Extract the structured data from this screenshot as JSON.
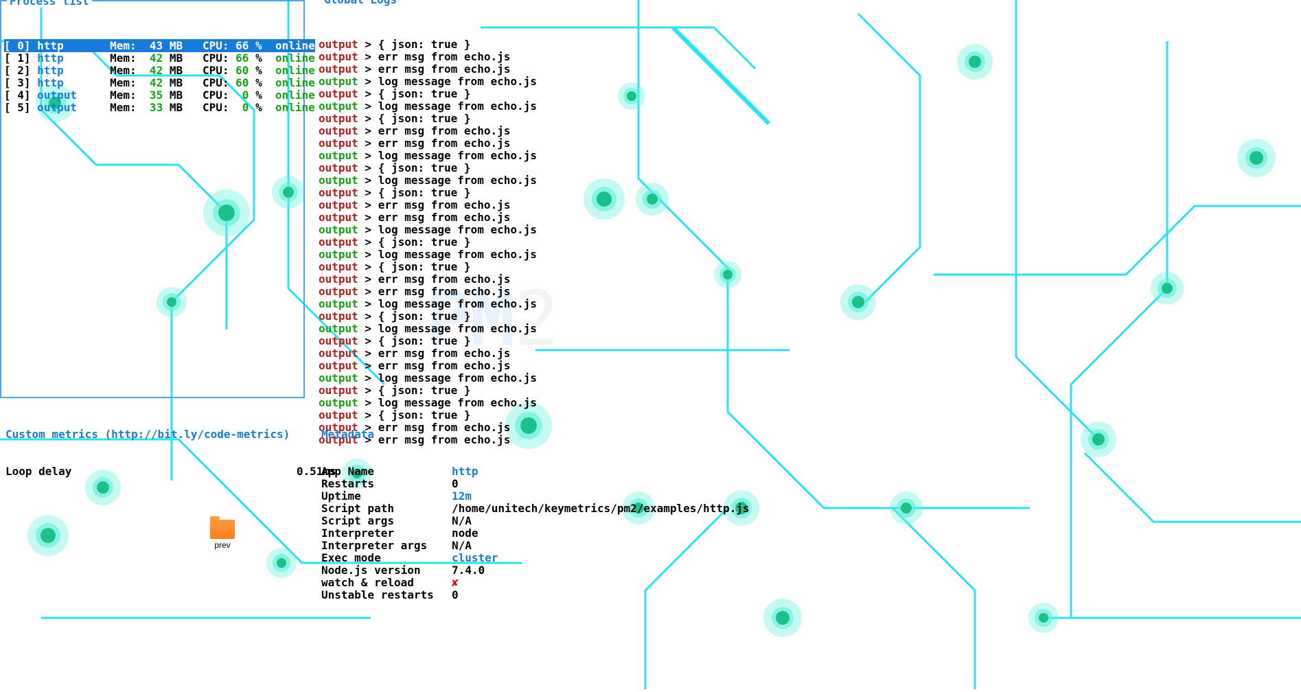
{
  "process_list": {
    "title": "Process list",
    "selected_row": {
      "id": "0",
      "name": "http",
      "mem": "43",
      "mem_unit": "MB",
      "cpu": "66",
      "status": "online"
    },
    "rows": [
      {
        "id": "1",
        "name": "http",
        "mem": "42",
        "mem_unit": "MB",
        "cpu": "66",
        "status": "online"
      },
      {
        "id": "2",
        "name": "http",
        "mem": "42",
        "mem_unit": "MB",
        "cpu": "60",
        "status": "online"
      },
      {
        "id": "3",
        "name": "http",
        "mem": "42",
        "mem_unit": "MB",
        "cpu": "60",
        "status": "online"
      },
      {
        "id": "4",
        "name": "output",
        "mem": "35",
        "mem_unit": "MB",
        "cpu": "0",
        "status": "online"
      },
      {
        "id": "5",
        "name": "output",
        "mem": "33",
        "mem_unit": "MB",
        "cpu": "0",
        "status": "online"
      }
    ]
  },
  "logs": {
    "title": "Global Logs",
    "lines": [
      {
        "label_color": "red",
        "msg": "{ json: true }"
      },
      {
        "label_color": "red",
        "msg": "err msg from echo.js"
      },
      {
        "label_color": "red",
        "msg": "err msg from echo.js"
      },
      {
        "label_color": "green",
        "msg": "log message from echo.js"
      },
      {
        "label_color": "red",
        "msg": "{ json: true }"
      },
      {
        "label_color": "green",
        "msg": "log message from echo.js"
      },
      {
        "label_color": "red",
        "msg": "{ json: true }"
      },
      {
        "label_color": "red",
        "msg": "err msg from echo.js"
      },
      {
        "label_color": "red",
        "msg": "err msg from echo.js"
      },
      {
        "label_color": "green",
        "msg": "log message from echo.js"
      },
      {
        "label_color": "red",
        "msg": "{ json: true }"
      },
      {
        "label_color": "green",
        "msg": "log message from echo.js"
      },
      {
        "label_color": "red",
        "msg": "{ json: true }"
      },
      {
        "label_color": "red",
        "msg": "err msg from echo.js"
      },
      {
        "label_color": "red",
        "msg": "err msg from echo.js"
      },
      {
        "label_color": "green",
        "msg": "log message from echo.js"
      },
      {
        "label_color": "red",
        "msg": "{ json: true }"
      },
      {
        "label_color": "green",
        "msg": "log message from echo.js"
      },
      {
        "label_color": "red",
        "msg": "{ json: true }"
      },
      {
        "label_color": "red",
        "msg": "err msg from echo.js"
      },
      {
        "label_color": "red",
        "msg": "err msg from echo.js"
      },
      {
        "label_color": "green",
        "msg": "log message from echo.js"
      },
      {
        "label_color": "red",
        "msg": "{ json: true }"
      },
      {
        "label_color": "green",
        "msg": "log message from echo.js"
      },
      {
        "label_color": "red",
        "msg": "{ json: true }"
      },
      {
        "label_color": "red",
        "msg": "err msg from echo.js"
      },
      {
        "label_color": "red",
        "msg": "err msg from echo.js"
      },
      {
        "label_color": "green",
        "msg": "log message from echo.js"
      },
      {
        "label_color": "red",
        "msg": "{ json: true }"
      },
      {
        "label_color": "green",
        "msg": "log message from echo.js"
      },
      {
        "label_color": "red",
        "msg": "{ json: true }"
      },
      {
        "label_color": "red",
        "msg": "err msg from echo.js"
      },
      {
        "label_color": "red",
        "msg": "err msg from echo.js"
      }
    ],
    "label": "output",
    "sep": ">"
  },
  "metrics": {
    "title": "Custom metrics (http://bit.ly/code-metrics)",
    "rows": [
      {
        "name": "Loop delay",
        "value": "0.51ms"
      }
    ]
  },
  "metadata": {
    "title": "Metadata",
    "rows": [
      {
        "k": "App Name",
        "v": "http",
        "color": "blue"
      },
      {
        "k": "Restarts",
        "v": "0",
        "color": ""
      },
      {
        "k": "Uptime",
        "v": "12m",
        "color": "blue"
      },
      {
        "k": "Script path",
        "v": "/home/unitech/keymetrics/pm2/examples/http.js",
        "color": ""
      },
      {
        "k": "Script args",
        "v": "N/A",
        "color": ""
      },
      {
        "k": "Interpreter",
        "v": "node",
        "color": ""
      },
      {
        "k": "Interpreter args",
        "v": "N/A",
        "color": ""
      },
      {
        "k": "Exec mode",
        "v": "cluster",
        "color": "blue"
      },
      {
        "k": "Node.js version",
        "v": "7.4.0",
        "color": ""
      },
      {
        "k": "watch & reload",
        "v": "✘",
        "color": "red"
      },
      {
        "k": "Unstable restarts",
        "v": "0",
        "color": ""
      }
    ]
  },
  "watermark": {
    "pm": "PM",
    "two": "2"
  },
  "desktop_icon": {
    "label": "prev"
  }
}
